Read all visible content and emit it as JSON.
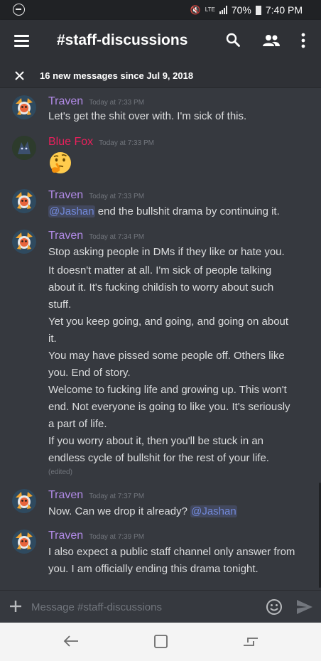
{
  "status_bar": {
    "network": "LTE",
    "battery": "70%",
    "time": "7:40 PM"
  },
  "header": {
    "channel_name": "#staff-discussions",
    "icons": [
      "hamburger-menu-icon",
      "search-icon",
      "members-icon",
      "more-vert-icon"
    ]
  },
  "new_messages_bar": {
    "text": "16 new messages since Jul 9, 2018"
  },
  "messages": [
    {
      "author": "Traven",
      "author_color": "#b18ae6",
      "timestamp": "Today at 7:33 PM",
      "lines": [
        "Let's get the shit over with. I'm sick of this."
      ]
    },
    {
      "author": "Blue Fox",
      "author_color": "#e9205c",
      "timestamp": "Today at 7:33 PM",
      "emoji": "thinking-face"
    },
    {
      "author": "Traven",
      "author_color": "#b18ae6",
      "timestamp": "Today at 7:33 PM",
      "mention": "@Jashan",
      "text": " end the bullshit drama by continuing it."
    },
    {
      "author": "Traven",
      "author_color": "#b18ae6",
      "timestamp": "Today at 7:34 PM",
      "lines": [
        "Stop asking people in DMs if they like or hate you.",
        "It doesn't matter at all. I'm sick of people talking",
        "about it. It's fucking childish to worry about such",
        "stuff.",
        "Yet you keep going, and going, and going on about",
        "it.",
        "You may have pissed some people off. Others like",
        "you. End of story.",
        "Welcome to fucking life and growing up. This won't",
        "end. Not everyone is going to like you. It's seriously",
        "a part of life.",
        "If you worry about it, then you'll be stuck in an",
        "endless cycle of bullshit for the rest of your life."
      ],
      "edited": "(edited)"
    },
    {
      "author": "Traven",
      "author_color": "#b18ae6",
      "timestamp": "Today at 7:37 PM",
      "text": "Now. Can we drop it already? ",
      "mention": "@Jashan"
    },
    {
      "author": "Traven",
      "author_color": "#b18ae6",
      "timestamp": "Today at 7:39 PM",
      "lines": [
        "I also expect a public staff channel only answer from",
        "you. I am officially ending this drama tonight."
      ]
    }
  ],
  "composer": {
    "placeholder": "Message #staff-discussions"
  },
  "colors": {
    "background": "#36393f",
    "header": "#2f3136",
    "mention": "#7289da"
  }
}
